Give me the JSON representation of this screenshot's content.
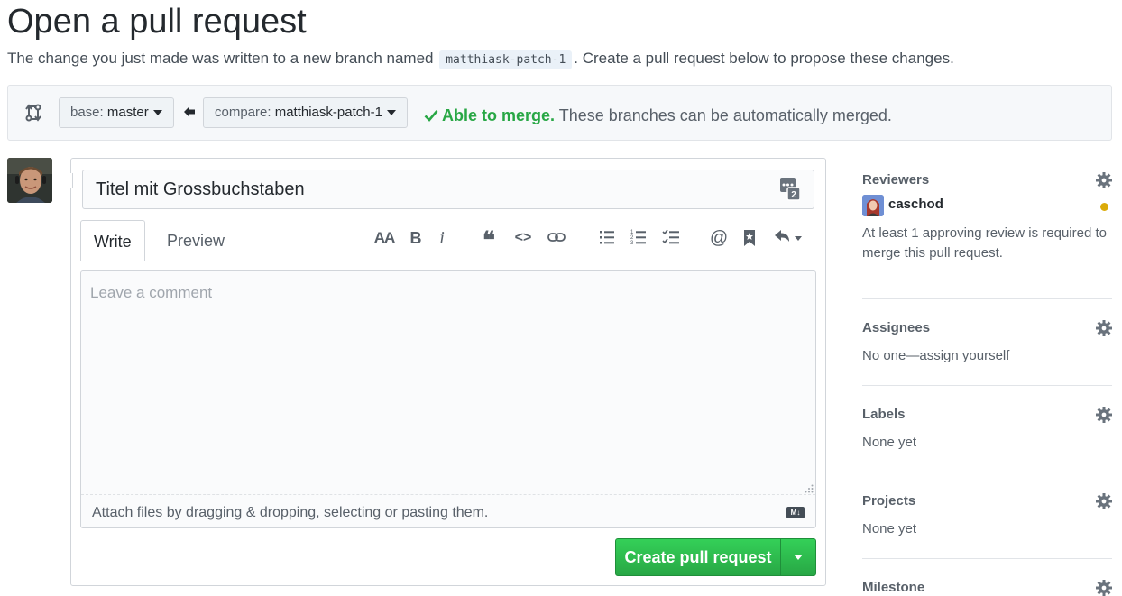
{
  "page": {
    "title": "Open a pull request",
    "subtitle_before": "The change you just made was written to a new branch named",
    "branch_name": "matthiask-patch-1",
    "subtitle_after": ". Create a pull request below to propose these changes."
  },
  "compare": {
    "base_prefix": "base:",
    "base_value": "master",
    "compare_prefix": "compare:",
    "compare_value": "matthiask-patch-1",
    "merge_ok": "Able to merge.",
    "merge_text": "These branches can be automatically merged."
  },
  "form": {
    "title_value": "Titel mit Grossbuchstaben",
    "tab_write": "Write",
    "tab_preview": "Preview",
    "toolbar": {
      "heading": "AA",
      "bold": "B",
      "italic": "i",
      "quote": "❝",
      "code": "<>",
      "mention": "@"
    },
    "comment_placeholder": "Leave a comment",
    "attach_text": "Attach files by dragging & dropping, selecting or pasting them.",
    "markdown_badge": "M↓",
    "submit_label": "Create pull request"
  },
  "sidebar": {
    "reviewers": {
      "heading": "Reviewers",
      "reviewer_name": "caschod",
      "note": "At least 1 approving review is required to merge this pull request."
    },
    "assignees": {
      "heading": "Assignees",
      "value": "No one—assign yourself"
    },
    "labels": {
      "heading": "Labels",
      "value": "None yet"
    },
    "projects": {
      "heading": "Projects",
      "value": "None yet"
    },
    "milestone": {
      "heading": "Milestone"
    }
  },
  "colors": {
    "accent_green": "#28a745",
    "pending_yellow": "#dbab09",
    "link_blue": "#0366d6"
  }
}
